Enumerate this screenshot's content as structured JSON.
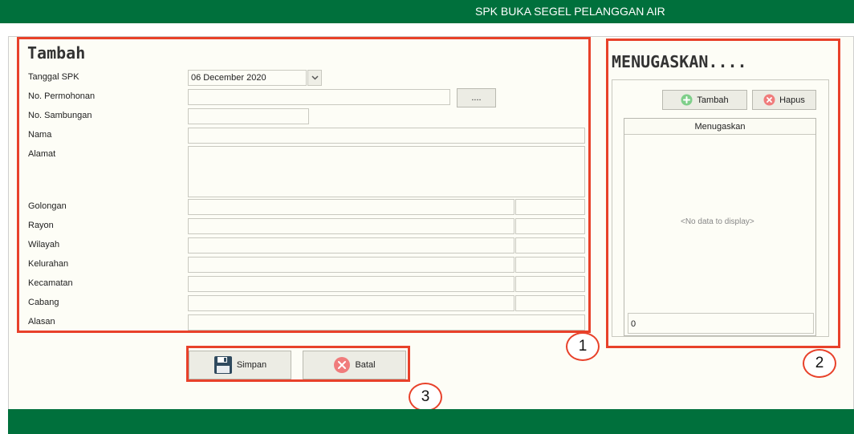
{
  "header": {
    "title": "SPK BUKA SEGEL PELANGGAN AIR"
  },
  "form": {
    "heading": "Tambah",
    "fields": {
      "tanggal_spk": {
        "label": "Tanggal SPK",
        "value": "06 December 2020"
      },
      "no_permohonan": {
        "label": "No. Permohonan",
        "value": "",
        "browse_label": "...."
      },
      "no_sambungan": {
        "label": "No. Sambungan",
        "value": ""
      },
      "nama": {
        "label": "Nama",
        "value": ""
      },
      "alamat": {
        "label": "Alamat",
        "value": ""
      },
      "golongan": {
        "label": "Golongan"
      },
      "rayon": {
        "label": "Rayon"
      },
      "wilayah": {
        "label": "Wilayah"
      },
      "kelurahan": {
        "label": "Kelurahan"
      },
      "kecamatan": {
        "label": "Kecamatan"
      },
      "cabang": {
        "label": "Cabang"
      },
      "alasan": {
        "label": "Alasan",
        "value": ""
      }
    }
  },
  "actions": {
    "save_label": "Simpan",
    "cancel_label": "Batal"
  },
  "assign_panel": {
    "heading": "MENUGASKAN....",
    "add_label": "Tambah",
    "delete_label": "Hapus",
    "column_header": "Menugaskan",
    "empty_text": "<No data to display>",
    "footer_count": "0"
  },
  "callouts": [
    "1",
    "2",
    "3"
  ],
  "colors": {
    "brand_green": "#00703c",
    "highlight_red": "#e8412a"
  }
}
